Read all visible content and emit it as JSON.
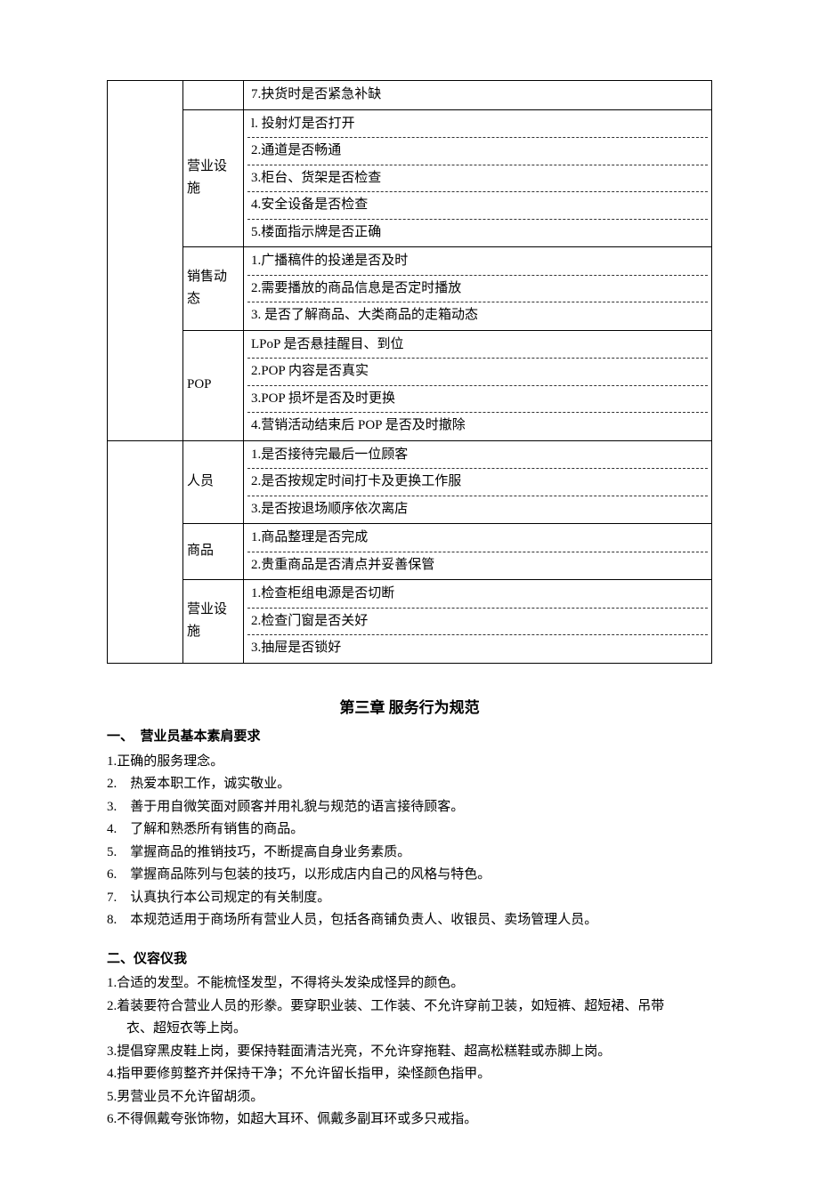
{
  "table": {
    "block1": {
      "left": "",
      "groups": [
        {
          "label": "",
          "items": [
            "7.抉货时是否紧急补缺"
          ]
        },
        {
          "label": "营业设施",
          "items": [
            "l. 投射灯是否打开",
            "2.通道是否畅通",
            "3.柜台、货架是否检查",
            "4.安全设备是否检查",
            "5.楼面指示牌是否正确"
          ]
        },
        {
          "label": "销售动态",
          "items": [
            "1.广播稿件的投递是否及时",
            "2.需要播放的商品信息是否定时播放",
            "3. 是否了解商品、大类商品的走箱动态"
          ]
        },
        {
          "label": "POP",
          "items": [
            "LPoP 是否悬挂醒目、到位",
            "2.POP 内容是否真实",
            "3.POP 损坏是否及时更换",
            "4.营销活动结束后 POP 是否及时撤除"
          ]
        }
      ]
    },
    "block2": {
      "left": "",
      "groups": [
        {
          "label": "人员",
          "items": [
            "1.是否接待完最后一位顾客",
            "2.是否按规定时间打卡及更换工作服",
            "3.是否按退场顺序依次离店"
          ]
        },
        {
          "label": "商品",
          "items": [
            "1.商品整理是否完成",
            "2.贵重商品是否清点并妥善保管"
          ]
        },
        {
          "label": "营业设施",
          "items": [
            "1.检查柜组电源是否切断",
            "2.检查门窗是否关好",
            "3.抽屉是否锁好"
          ]
        }
      ]
    }
  },
  "chapter": "第三章 服务行为规范",
  "sec1": {
    "title": "一、　营业员基本素肩要求",
    "items": [
      "1.正确的服务理念。",
      "2.　热爱本职工作，诚实敬业。",
      "3.　善于用自微笑面对顾客并用礼貌与规范的语言接待顾客。",
      "4.　了解和熟悉所有销售的商品。",
      "5.　掌握商品的推销技巧，不断提高自身业务素质。",
      "6.　掌握商品陈列与包装的技巧，以形成店内自己的风格与特色。",
      "7.　认真执行本公司规定的有关制度。",
      "8.　本规范适用于商场所有营业人员，包括各商铺负责人、收银员、卖场管理人员。"
    ]
  },
  "sec2": {
    "title": "二、仪容仪我",
    "items": [
      "1.合适的发型。不能梳怪发型，不得将头发染成怪异的颜色。",
      "2.着装要符合营业人员的形豢。要穿职业装、工作装、不允许穿前卫装，如短裤、超短裙、吊带",
      "衣、超短衣等上岗。",
      "3.提倡穿黑皮鞋上岗，要保持鞋面清洁光亮，不允许穿拖鞋、超高松糕鞋或赤脚上岗。",
      "4.指甲要修剪整齐并保持干净；不允许留长指甲，染怪颜色指甲。",
      "5.男营业员不允许留胡须。",
      "6.不得佩戴夸张饰物，如超大耳环、佩戴多副耳环或多只戒指。"
    ]
  }
}
